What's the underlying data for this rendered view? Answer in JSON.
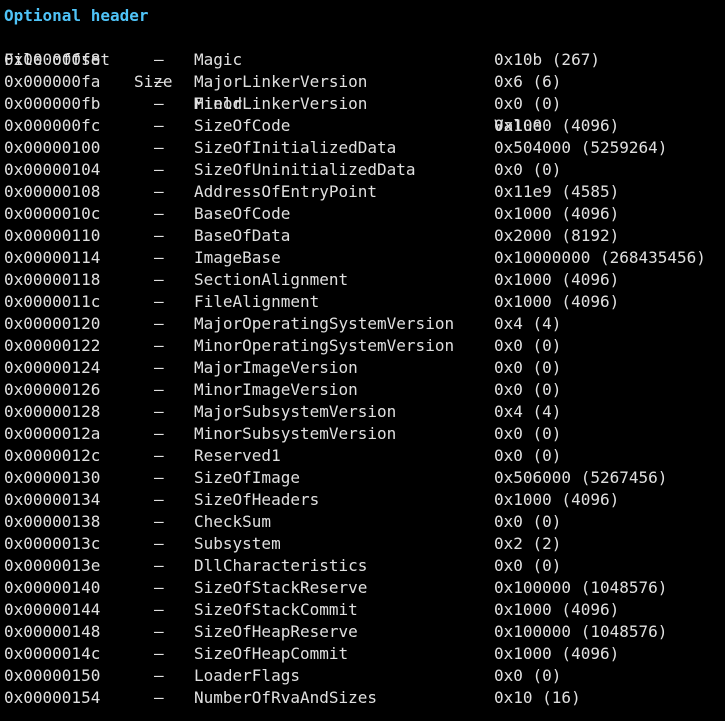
{
  "section_title": "Optional header",
  "columns": {
    "offset": "File offset",
    "size": "Size",
    "field": "Field",
    "value": "Value"
  },
  "colors": {
    "title": "#4fc3f7",
    "text": "#e0e0e0",
    "background": "#000000"
  },
  "rows": [
    {
      "offset": "0x000000f8",
      "size": "—",
      "field": "Magic",
      "value": "0x10b (267)"
    },
    {
      "offset": "0x000000fa",
      "size": "—",
      "field": "MajorLinkerVersion",
      "value": "0x6 (6)"
    },
    {
      "offset": "0x000000fb",
      "size": "—",
      "field": "MinorLinkerVersion",
      "value": "0x0 (0)"
    },
    {
      "offset": "0x000000fc",
      "size": "—",
      "field": "SizeOfCode",
      "value": "0x1000 (4096)"
    },
    {
      "offset": "0x00000100",
      "size": "—",
      "field": "SizeOfInitializedData",
      "value": "0x504000 (5259264)"
    },
    {
      "offset": "0x00000104",
      "size": "—",
      "field": "SizeOfUninitializedData",
      "value": "0x0 (0)"
    },
    {
      "offset": "0x00000108",
      "size": "—",
      "field": "AddressOfEntryPoint",
      "value": "0x11e9 (4585)"
    },
    {
      "offset": "0x0000010c",
      "size": "—",
      "field": "BaseOfCode",
      "value": "0x1000 (4096)"
    },
    {
      "offset": "0x00000110",
      "size": "—",
      "field": "BaseOfData",
      "value": "0x2000 (8192)"
    },
    {
      "offset": "0x00000114",
      "size": "—",
      "field": "ImageBase",
      "value": "0x10000000 (268435456)"
    },
    {
      "offset": "0x00000118",
      "size": "—",
      "field": "SectionAlignment",
      "value": "0x1000 (4096)"
    },
    {
      "offset": "0x0000011c",
      "size": "—",
      "field": "FileAlignment",
      "value": "0x1000 (4096)"
    },
    {
      "offset": "0x00000120",
      "size": "—",
      "field": "MajorOperatingSystemVersion",
      "value": "0x4 (4)"
    },
    {
      "offset": "0x00000122",
      "size": "—",
      "field": "MinorOperatingSystemVersion",
      "value": "0x0 (0)"
    },
    {
      "offset": "0x00000124",
      "size": "—",
      "field": "MajorImageVersion",
      "value": "0x0 (0)"
    },
    {
      "offset": "0x00000126",
      "size": "—",
      "field": "MinorImageVersion",
      "value": "0x0 (0)"
    },
    {
      "offset": "0x00000128",
      "size": "—",
      "field": "MajorSubsystemVersion",
      "value": "0x4 (4)"
    },
    {
      "offset": "0x0000012a",
      "size": "—",
      "field": "MinorSubsystemVersion",
      "value": "0x0 (0)"
    },
    {
      "offset": "0x0000012c",
      "size": "—",
      "field": "Reserved1",
      "value": "0x0 (0)"
    },
    {
      "offset": "0x00000130",
      "size": "—",
      "field": "SizeOfImage",
      "value": "0x506000 (5267456)"
    },
    {
      "offset": "0x00000134",
      "size": "—",
      "field": "SizeOfHeaders",
      "value": "0x1000 (4096)"
    },
    {
      "offset": "0x00000138",
      "size": "—",
      "field": "CheckSum",
      "value": "0x0 (0)"
    },
    {
      "offset": "0x0000013c",
      "size": "—",
      "field": "Subsystem",
      "value": "0x2 (2)"
    },
    {
      "offset": "0x0000013e",
      "size": "—",
      "field": "DllCharacteristics",
      "value": "0x0 (0)"
    },
    {
      "offset": "0x00000140",
      "size": "—",
      "field": "SizeOfStackReserve",
      "value": "0x100000 (1048576)"
    },
    {
      "offset": "0x00000144",
      "size": "—",
      "field": "SizeOfStackCommit",
      "value": "0x1000 (4096)"
    },
    {
      "offset": "0x00000148",
      "size": "—",
      "field": "SizeOfHeapReserve",
      "value": "0x100000 (1048576)"
    },
    {
      "offset": "0x0000014c",
      "size": "—",
      "field": "SizeOfHeapCommit",
      "value": "0x1000 (4096)"
    },
    {
      "offset": "0x00000150",
      "size": "—",
      "field": "LoaderFlags",
      "value": "0x0 (0)"
    },
    {
      "offset": "0x00000154",
      "size": "—",
      "field": "NumberOfRvaAndSizes",
      "value": "0x10 (16)"
    }
  ]
}
